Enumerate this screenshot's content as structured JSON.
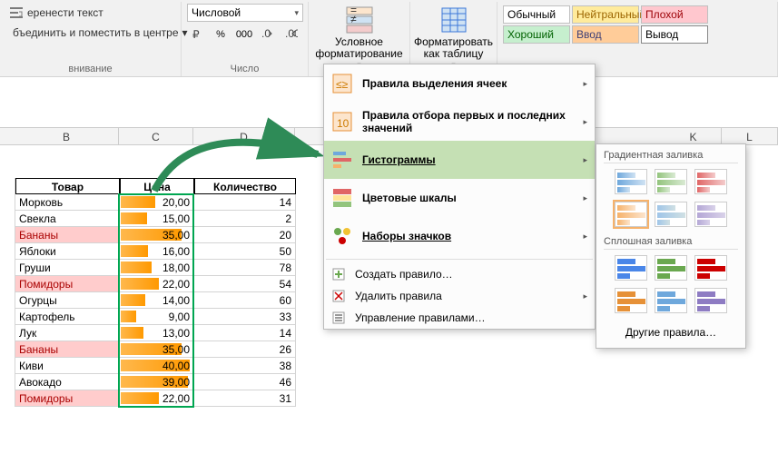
{
  "ribbon": {
    "wrap_text": "еренести текст",
    "merge_center": "бъединить и поместить в центре",
    "align_label": "внивание",
    "number_format": "Числовой",
    "number_label": "Число",
    "cond_format": "Условное форматирование",
    "format_table": "Форматировать как таблицу",
    "styles": {
      "normal": "Обычный",
      "neutral": "Нейтральный",
      "bad": "Плохой",
      "good": "Хороший",
      "input": "Ввод",
      "output": "Вывод"
    }
  },
  "columns": {
    "B": "B",
    "C": "C",
    "D": "D",
    "K": "K",
    "L": "L"
  },
  "table": {
    "headers": {
      "product": "Товар",
      "price": "Цена",
      "qty": "Количество"
    },
    "rows": [
      {
        "product": "Морковь",
        "price": "20,00",
        "qty": "14",
        "bar": 50,
        "bad": false
      },
      {
        "product": "Свекла",
        "price": "15,00",
        "qty": "2",
        "bar": 38,
        "bad": false
      },
      {
        "product": "Бананы",
        "price": "35,00",
        "qty": "20",
        "bar": 88,
        "bad": true
      },
      {
        "product": "Яблоки",
        "price": "16,00",
        "qty": "50",
        "bar": 40,
        "bad": false
      },
      {
        "product": "Груши",
        "price": "18,00",
        "qty": "78",
        "bar": 45,
        "bad": false
      },
      {
        "product": "Помидоры",
        "price": "22,00",
        "qty": "54",
        "bar": 55,
        "bad": true
      },
      {
        "product": "Огурцы",
        "price": "14,00",
        "qty": "60",
        "bar": 35,
        "bad": false
      },
      {
        "product": "Картофель",
        "price": "9,00",
        "qty": "33",
        "bar": 23,
        "bad": false
      },
      {
        "product": "Лук",
        "price": "13,00",
        "qty": "14",
        "bar": 33,
        "bad": false
      },
      {
        "product": "Бананы",
        "price": "35,00",
        "qty": "26",
        "bar": 88,
        "bad": true
      },
      {
        "product": "Киви",
        "price": "40,00",
        "qty": "38",
        "bar": 100,
        "bad": false
      },
      {
        "product": "Авокадо",
        "price": "39,00",
        "qty": "46",
        "bar": 98,
        "bad": false
      },
      {
        "product": "Помидоры",
        "price": "22,00",
        "qty": "31",
        "bar": 55,
        "bad": true
      }
    ]
  },
  "menu": {
    "highlight_rules": "Правила выделения ячеек",
    "top_bottom": "Правила отбора первых и последних значений",
    "data_bars": "Гистограммы",
    "color_scales": "Цветовые шкалы",
    "icon_sets": "Наборы значков",
    "new_rule": "Создать правило…",
    "clear_rules": "Удалить правила",
    "manage_rules": "Управление правилами…"
  },
  "submenu": {
    "gradient": "Градиентная заливка",
    "solid": "Сплошная заливка",
    "more": "Другие правила…"
  }
}
